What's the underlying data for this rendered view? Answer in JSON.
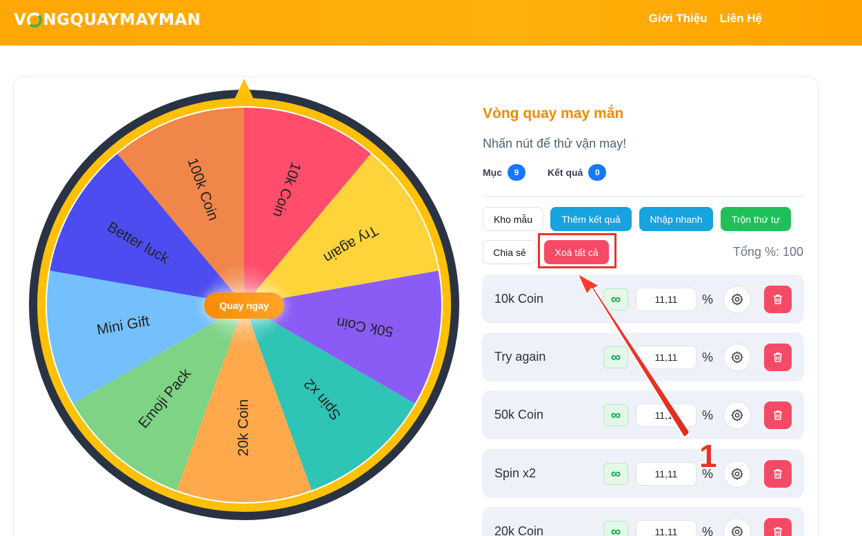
{
  "header": {
    "logo": {
      "part1": "V",
      "part2": "NGQUAYMAYMAN"
    },
    "nav": [
      "Giới Thiệu",
      "Liên Hệ"
    ]
  },
  "wheel": {
    "spin_label": "Quay ngay",
    "segments": [
      {
        "label": "10k Coin",
        "color": "#ff4d6b"
      },
      {
        "label": "Try again",
        "color": "#ffd43b"
      },
      {
        "label": "50k Coin",
        "color": "#8a5cf5"
      },
      {
        "label": "Spin x2",
        "color": "#2ec4b6"
      },
      {
        "label": "20k Coin",
        "color": "#ffa94d"
      },
      {
        "label": "Emoji Pack",
        "color": "#7ed385"
      },
      {
        "label": "Mini Gift",
        "color": "#74c0fc"
      },
      {
        "label": "Better luck",
        "color": "#4c4cf0"
      },
      {
        "label": "100k Coin",
        "color": "#f0864a"
      }
    ],
    "rim_color": "#ffc107",
    "border_color": "#2a3344"
  },
  "panel": {
    "title": "Vòng quay may mắn",
    "subtitle": "Nhấn nút để thử vận may!",
    "items_label": "Mục",
    "items_count": "9",
    "results_label": "Kết quả",
    "results_count": "0",
    "buttons": {
      "templates": "Kho mẫu",
      "add_result": "Thêm kết quả",
      "quick_input": "Nhập nhanh",
      "shuffle": "Trộn thứ tự",
      "share": "Chia sẻ",
      "clear_all": "Xoá tất cả"
    },
    "total": "Tổng %: 100",
    "infinity_symbol": "∞",
    "percent_symbol": "%",
    "rows": [
      {
        "name": "10k Coin",
        "percent": "11,11"
      },
      {
        "name": "Try again",
        "percent": "11,11"
      },
      {
        "name": "50k Coin",
        "percent": "11,11"
      },
      {
        "name": "Spin x2",
        "percent": "11,11"
      },
      {
        "name": "20k Coin",
        "percent": "11,11"
      }
    ]
  },
  "annotation": {
    "step": "1",
    "color": "#e53524"
  }
}
